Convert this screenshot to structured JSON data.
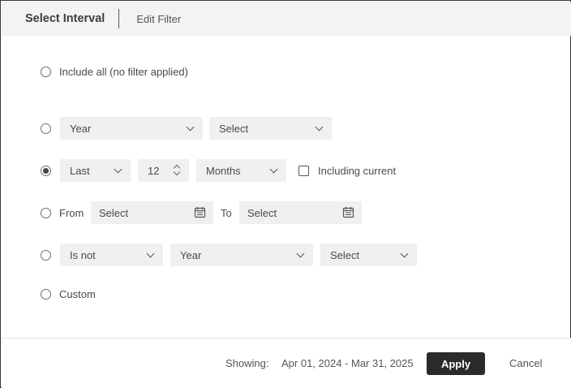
{
  "header": {
    "title": "Select Interval",
    "tab": "Edit Filter"
  },
  "options": {
    "include_all": "Include all (no filter applied)",
    "period": {
      "unit": "Year",
      "value": "Select"
    },
    "relative": {
      "direction": "Last",
      "count": "12",
      "unit": "Months",
      "including_current": "Including current"
    },
    "range": {
      "from_label": "From",
      "from_value": "Select",
      "to_label": "To",
      "to_value": "Select"
    },
    "exclude": {
      "operator": "Is not",
      "unit": "Year",
      "value": "Select"
    },
    "custom": "Custom"
  },
  "selected_option": "relative",
  "footer": {
    "showing_label": "Showing:",
    "showing_value": "Apr 01, 2024 - Mar 31, 2025",
    "apply": "Apply",
    "cancel": "Cancel"
  }
}
